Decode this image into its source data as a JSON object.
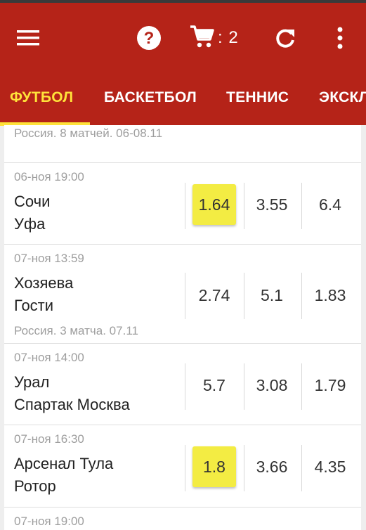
{
  "toolbar": {
    "cart_count": ": 2"
  },
  "tabs": [
    {
      "label": "ФУТБОЛ"
    },
    {
      "label": "БАСКЕТБОЛ"
    },
    {
      "label": "ТЕННИС"
    },
    {
      "label": "ЭКСКЛ"
    }
  ],
  "list": {
    "group_header": "Россия. 8 матчей. 06-08.11",
    "matches": [
      {
        "time": "06-ноя 19:00",
        "home": "Сочи",
        "away": "Уфа",
        "odds": [
          "1.64",
          "3.55",
          "6.4"
        ],
        "footer": ""
      },
      {
        "time": "07-ноя 13:59",
        "home": "Хозяева",
        "away": "Гости",
        "odds": [
          "2.74",
          "5.1",
          "1.83"
        ],
        "footer": "Россия. 3 матча. 07.11"
      },
      {
        "time": "07-ноя 14:00",
        "home": "Урал",
        "away": "Спартак Москва",
        "odds": [
          "5.7",
          "3.08",
          "1.79"
        ],
        "footer": ""
      },
      {
        "time": "07-ноя 16:30",
        "home": "Арсенал Тула",
        "away": "Ротор",
        "odds": [
          "1.8",
          "3.66",
          "4.35"
        ],
        "footer": ""
      },
      {
        "time": "07-ноя 19:00",
        "home": "",
        "away": "",
        "odds": [],
        "footer": ""
      }
    ]
  },
  "colors": {
    "appbar": "#b52318",
    "active_tab": "#ffe23a",
    "selected_odd": "#f3ec43"
  }
}
